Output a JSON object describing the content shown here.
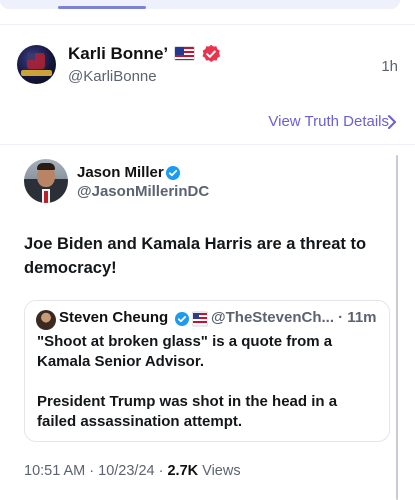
{
  "post": {
    "display_name": "Karli Bonne’",
    "handle": "@KarliBonne",
    "time_ago": "1h",
    "details_link": "View Truth Details",
    "colors": {
      "link": "#6a5fd6",
      "verified_badge": "#e8344e"
    }
  },
  "quoted_truth": {
    "display_name": "Jason Miller",
    "handle": "@JasonMillerinDC",
    "text": "Joe Biden and Kamala Harris are a threat to democracy!",
    "nested_quote": {
      "display_name": "Steven Cheung",
      "handle": "@TheStevenCh... · 11m",
      "text": "\"Shoot at broken glass\" is a quote from a Kamala Senior Advisor.\n\nPresident Trump was shot in the head in a failed assassination attempt."
    },
    "meta": {
      "timestamp": "10:51 AM · 10/23/24 · ",
      "views_count": "2.7K",
      "views_label": " Views"
    }
  },
  "icons": {
    "verified_red": "verified-badge-icon",
    "verified_blue": "verified-check-icon",
    "flag": "us-flag-icon",
    "chevron": "chevron-right-icon"
  }
}
